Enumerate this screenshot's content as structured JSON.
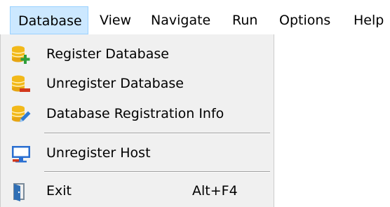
{
  "menubar": {
    "items": [
      {
        "label": "Database"
      },
      {
        "label": "View"
      },
      {
        "label": "Navigate"
      },
      {
        "label": "Run"
      },
      {
        "label": "Options"
      },
      {
        "label": "Help"
      }
    ]
  },
  "dropdown": {
    "items": [
      {
        "label": "Register Database",
        "icon": "database-add-icon"
      },
      {
        "label": "Unregister Database",
        "icon": "database-remove-icon"
      },
      {
        "label": "Database Registration Info",
        "icon": "database-edit-icon"
      },
      {
        "label": "Unregister Host",
        "icon": "monitor-icon"
      },
      {
        "label": "Exit",
        "shortcut": "Alt+F4",
        "icon": "exit-door-icon"
      }
    ]
  },
  "colors": {
    "active_menu_bg": "#cce8ff",
    "dropdown_bg": "#f0f0f0",
    "database_icon": "#f2b91a",
    "add_sign": "#2e9e3a",
    "remove_sign": "#d2381c",
    "edit_pencil": "#2f7bd6",
    "monitor": "#2a6fd1"
  }
}
